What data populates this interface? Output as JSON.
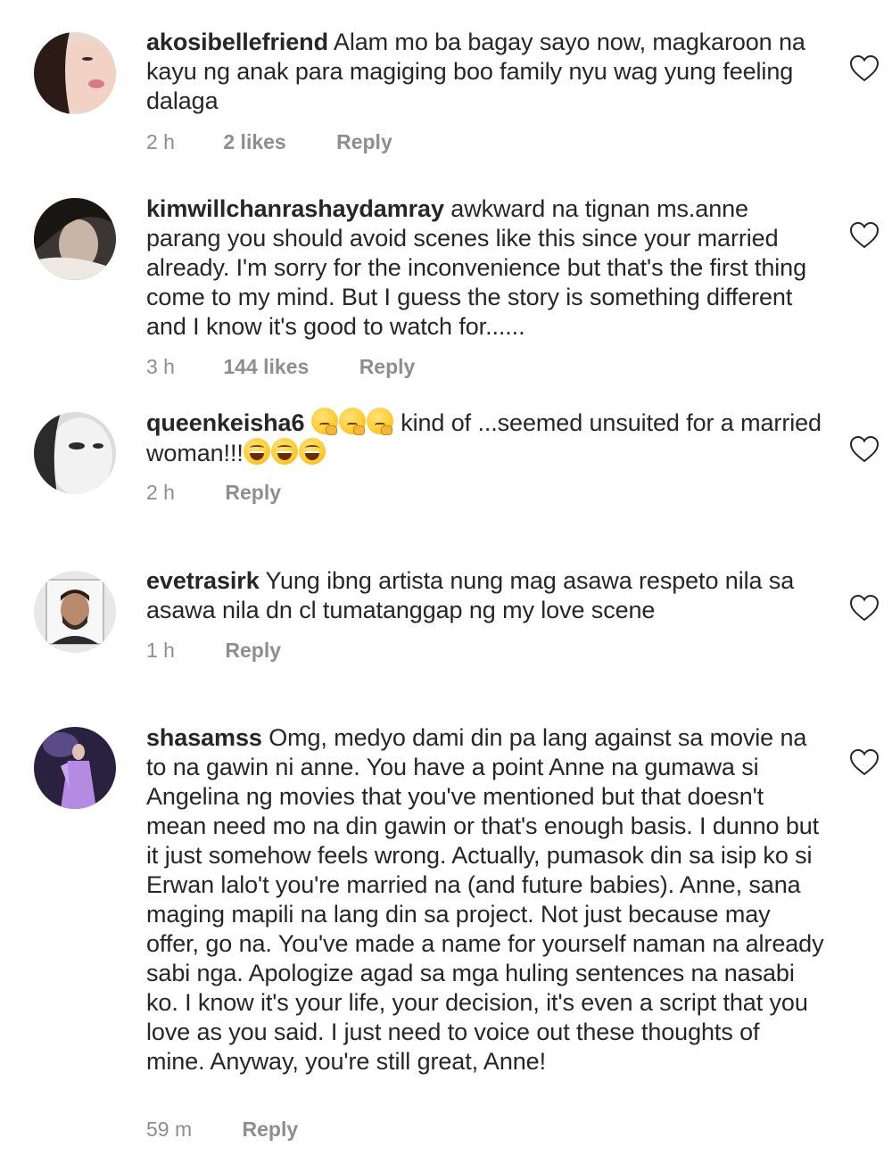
{
  "comments": [
    {
      "username": "akosibellefriend",
      "text": "Alam mo ba bagay sayo now, magkaroon na kayu ng anak para magiging boo family nyu wag yung feeling dalaga",
      "time": "2 h",
      "likes": "2 likes",
      "reply": "Reply",
      "avatar": "woman-selfie-avatar",
      "like_icon": "heart-outline-icon"
    },
    {
      "username": "kimwillchanrashaydamray",
      "text": "awkward na tignan ms.anne parang you should avoid scenes like this since your married already. I'm sorry for the inconvenience but that's the first thing come to my mind. But I guess the story is something different and I know it's good to watch for......",
      "time": "3 h",
      "likes": "144 likes",
      "reply": "Reply",
      "avatar": "dark-portrait-avatar",
      "like_icon": "heart-outline-icon"
    },
    {
      "username": "queenkeisha6",
      "text_before_emoji": "kind of ...seemed  unsuited for a married woman!!!",
      "emoji_thinking": "🤔🤔🤔",
      "emoji_laughing": "😅😅😅",
      "time": "2 h",
      "reply": "Reply",
      "avatar": "grayscale-selfie-avatar",
      "like_icon": "heart-outline-icon"
    },
    {
      "username": "evetrasirk",
      "text": "Yung ibng artista nung mag asawa respeto nila sa asawa nila dn cl tumatanggap ng my love scene",
      "time": "1 h",
      "reply": "Reply",
      "avatar": "man-portrait-avatar",
      "like_icon": "heart-outline-icon"
    },
    {
      "username": "shasamss",
      "text": "Omg, medyo dami din pa lang against sa movie na to na gawin ni anne. You have a point Anne na gumawa si Angelina ng movies that you've mentioned but that doesn't mean need mo na din gawin or that's enough basis. I dunno but it just somehow feels wrong. Actually, pumasok din sa isip ko si Erwan lalo't you're married na (and future babies). Anne, sana maging mapili na lang din sa project. Not just because may offer, go na. You've made a name for yourself naman na already sabi nga. Apologize agad sa mga huling sentences na nasabi ko. I know it's your life, your decision, it's even a script that you love as you said. I just need to voice out these thoughts of mine. Anyway, you're still great, Anne!",
      "time": "59 m",
      "reply": "Reply",
      "avatar": "purple-stage-avatar",
      "like_icon": "heart-outline-icon"
    }
  ]
}
